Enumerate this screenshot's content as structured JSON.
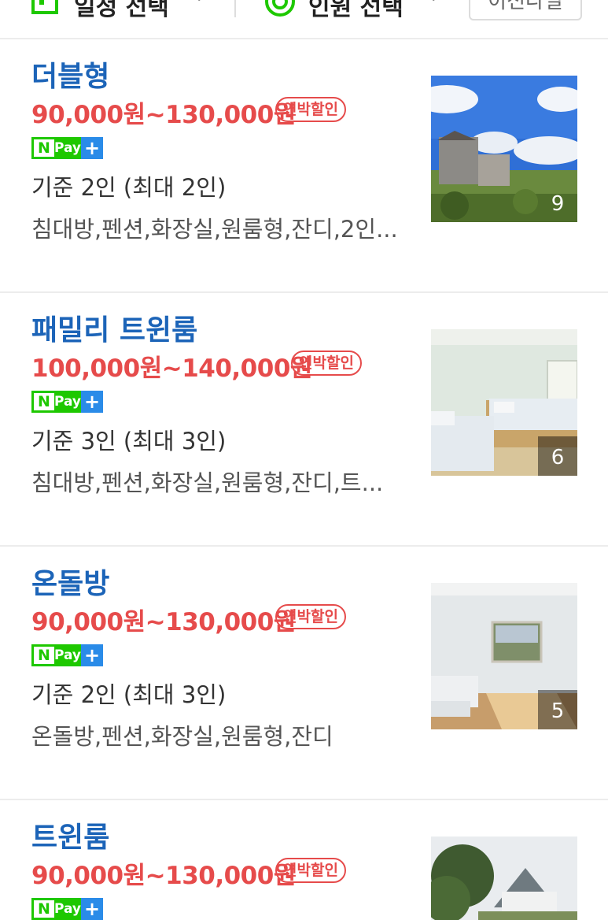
{
  "topbar": {
    "date_label": "일정 선택",
    "people_label": "인원 선택",
    "button_label": "이전다일"
  },
  "rooms": [
    {
      "name": "더블형",
      "price": "90,000원~130,000원",
      "badge": "연박할인",
      "npay": {
        "n": "N",
        "pay": "Pay",
        "plus": "+"
      },
      "capacity": "기준 2인 (최대 2인)",
      "amenities": "침대방,펜션,화장실,원룸형,잔디,2인...",
      "photo_count": "9"
    },
    {
      "name": "패밀리 트윈룸",
      "price": "100,000원~140,000원",
      "badge": "연박할인",
      "npay": {
        "n": "N",
        "pay": "Pay",
        "plus": "+"
      },
      "capacity": "기준 3인 (최대 3인)",
      "amenities": "침대방,펜션,화장실,원룸형,잔디,트...",
      "photo_count": "6"
    },
    {
      "name": "온돌방",
      "price": "90,000원~130,000원",
      "badge": "연박할인",
      "npay": {
        "n": "N",
        "pay": "Pay",
        "plus": "+"
      },
      "capacity": "기준 2인 (최대 3인)",
      "amenities": "온돌방,펜션,화장실,원룸형,잔디",
      "photo_count": "5"
    },
    {
      "name": "트윈룸",
      "price": "90,000원~130,000원",
      "badge": "연박할인",
      "npay": {
        "n": "N",
        "pay": "Pay",
        "plus": "+"
      }
    }
  ],
  "colors": {
    "room_name": "#1c64b8",
    "price": "#e64b4b",
    "npay_green": "#1ec800",
    "npay_blue": "#2a8be8"
  },
  "icons": [
    "calendar-icon",
    "chevron-down-icon",
    "person-icon",
    "naver-pay-icon"
  ]
}
